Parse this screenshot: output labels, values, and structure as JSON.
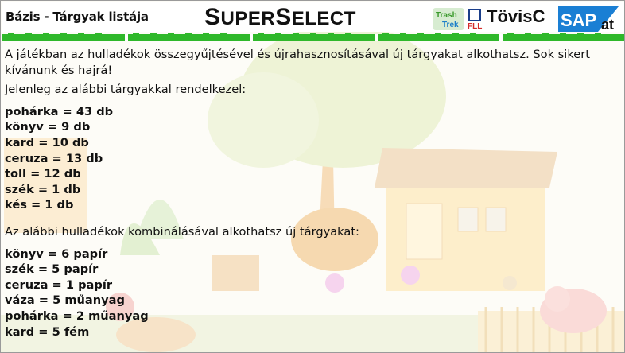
{
  "header": {
    "title": "Bázis - Tárgyak listája",
    "brand_big": "S",
    "brand_rest1": "UPER",
    "brand_big2": "S",
    "brand_rest2": "ELECT",
    "logo_trash_top": "Trash",
    "logo_trash_bottom": "Trek",
    "logo_fll": "FLL",
    "logo_tovis": "TövisC",
    "logo_sap": "SAP",
    "logo_at": "at"
  },
  "intro": "A játékban az hulladékok összegyűjtésével és újrahasznosításával új tárgyakat alkothatsz. Sok sikert kívánunk és hajrá!",
  "items_heading": "Jelenleg az alábbi tárgyakkal rendelkezel:",
  "items": [
    "pohárka = 43 db",
    "könyv = 9 db",
    "kard = 10 db",
    "ceruza = 13 db",
    "toll = 12 db",
    "szék = 1 db",
    "kés = 1 db"
  ],
  "combos_heading": "Az alábbi hulladékok kombinálásával alkothatsz új tárgyakat:",
  "combos": [
    "könyv = 6 papír",
    "szék = 5 papír",
    "ceruza = 1 papír",
    "váza = 5 műanyag",
    "pohárka = 2 műanyag",
    "kard = 5 fém"
  ],
  "colors": {
    "green": "#2fb82a",
    "sap_blue": "#1a7fd4"
  }
}
